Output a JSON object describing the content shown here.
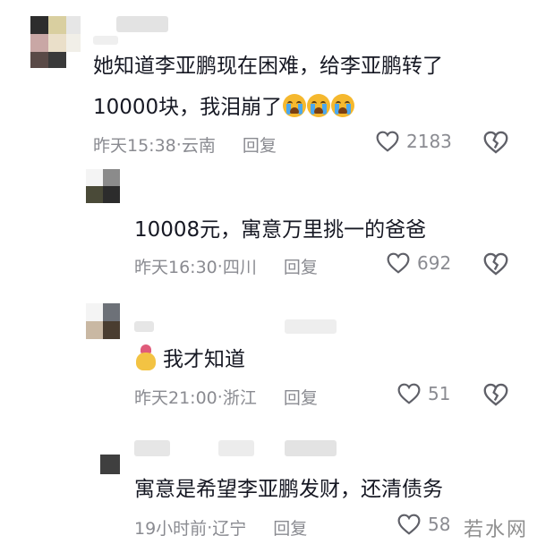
{
  "comments": [
    {
      "text_line1": "她知道李亚鹏现在困难，给李亚鹏转了",
      "text_line2": "10000块，我泪崩了",
      "emojis": [
        "crying-face-emoji",
        "crying-face-emoji",
        "crying-face-emoji"
      ],
      "time": "昨天15:38",
      "location": "云南",
      "reply_label": "回复",
      "likes": "2183"
    },
    {
      "text": "10008元，寓意万里挑一的爸爸",
      "time": "昨天16:30",
      "location": "四川",
      "reply_label": "回复",
      "likes": "692"
    },
    {
      "emoji": "heart-hands-emoji",
      "text": "我才知道",
      "time": "昨天21:00",
      "location": "浙江",
      "reply_label": "回复",
      "likes": "51"
    },
    {
      "text": "寓意是希望李亚鹏发财，还清债务",
      "time": "19小时前",
      "location": "辽宁",
      "reply_label": "回复",
      "likes": "58"
    }
  ],
  "meta_separator": " · ",
  "watermark": "若水网",
  "colors": {
    "text": "#161823",
    "meta": "#8a8b91",
    "background": "#ffffff"
  }
}
